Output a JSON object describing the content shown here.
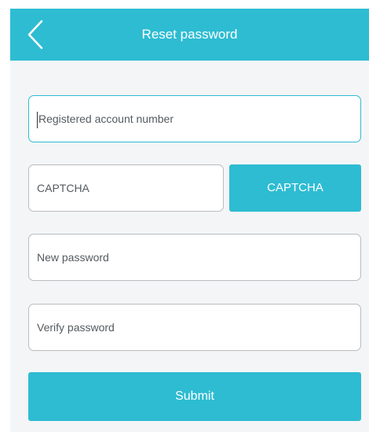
{
  "header": {
    "title": "Reset password",
    "back_icon": "chevron-left-icon"
  },
  "form": {
    "account": {
      "placeholder": "Registered account number",
      "value": ""
    },
    "captcha": {
      "placeholder": "CAPTCHA",
      "value": ""
    },
    "captcha_button_label": "CAPTCHA",
    "new_password": {
      "placeholder": "New password",
      "value": ""
    },
    "verify_password": {
      "placeholder": "Verify password",
      "value": ""
    },
    "submit_label": "Submit"
  },
  "colors": {
    "accent": "#2dbcd2",
    "background": "#f4f5f6",
    "field_border": "#b9bcbf"
  }
}
